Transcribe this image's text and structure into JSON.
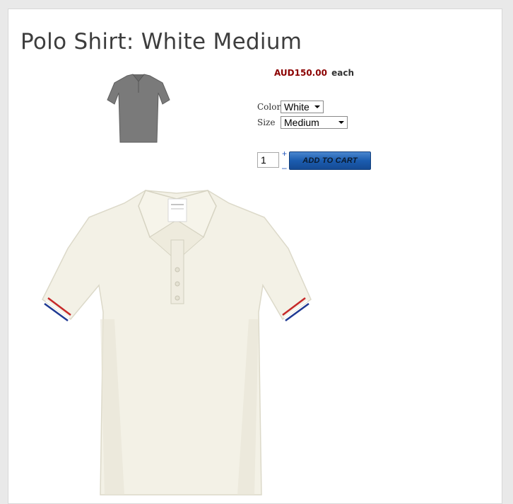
{
  "product": {
    "title": "Polo Shirt: White Medium",
    "price": "AUD150.00",
    "price_suffix": "each",
    "thumbnail_alt": "grey polo shirt thumbnail",
    "main_image_alt": "white polo shirt with striped sleeve cuffs"
  },
  "options": {
    "color": {
      "label": "Color",
      "selected": "White"
    },
    "size": {
      "label": "Size",
      "selected": "Medium"
    }
  },
  "cart": {
    "quantity": "1",
    "increment_label": "+",
    "decrement_label": "–",
    "add_button_label": "ADD TO CART"
  },
  "colors": {
    "price": "#8b0000",
    "button": "#1b5caf",
    "title": "#3d3d3d"
  }
}
